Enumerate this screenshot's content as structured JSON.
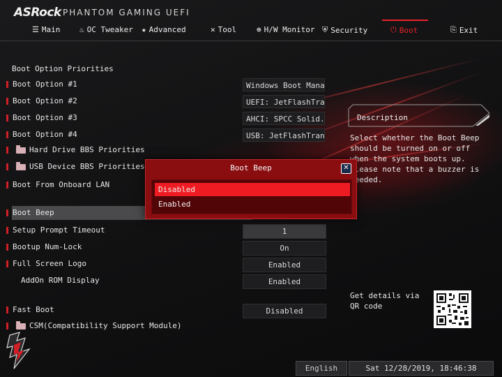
{
  "header": {
    "brand": "ASRock",
    "subtitle": "PHANTOM GAMING UEFI"
  },
  "nav": [
    {
      "label": "Main",
      "icon": "list-icon"
    },
    {
      "label": "OC Tweaker",
      "icon": "flame-icon"
    },
    {
      "label": "Advanced",
      "icon": "star-icon"
    },
    {
      "label": "Tool",
      "icon": "tools-icon"
    },
    {
      "label": "H/W Monitor",
      "icon": "globe-icon"
    },
    {
      "label": "Security",
      "icon": "shield-icon"
    },
    {
      "label": "Boot",
      "icon": "power-icon",
      "active": true
    },
    {
      "label": "Exit",
      "icon": "exit-icon"
    }
  ],
  "boot": {
    "section_title": "Boot Option Priorities",
    "options": [
      {
        "label": "Boot Option #1",
        "value": "Windows Boot Mana..."
      },
      {
        "label": "Boot Option #2",
        "value": "UEFI: JetFlashTra..."
      },
      {
        "label": "Boot Option #3",
        "value": "AHCI:  SPCC Solid..."
      },
      {
        "label": "Boot Option #4",
        "value": "USB: JetFlashTran..."
      }
    ],
    "hdd_bbs": "Hard Drive BBS Priorities",
    "usb_bbs": "USB Device BBS Priorities",
    "onboard_lan": "Boot From Onboard LAN",
    "boot_beep": "Boot Beep",
    "setup_prompt": {
      "label": "Setup Prompt Timeout",
      "value": "1"
    },
    "numlock": {
      "label": "Bootup Num-Lock",
      "value": "On"
    },
    "full_logo": {
      "label": "Full Screen Logo",
      "value": "Enabled"
    },
    "addon_rom": {
      "label": "AddOn ROM Display",
      "value": "Enabled"
    },
    "fast_boot": {
      "label": "Fast Boot",
      "value": "Disabled"
    },
    "csm": "CSM(Compatibility Support Module)"
  },
  "description": {
    "title": "Description",
    "text": "Select whether the Boot Beep should be turned on or off when the system boots up. Please note that a buzzer is needed."
  },
  "qr": {
    "text": "Get details via QR code"
  },
  "popup": {
    "title": "Boot Beep",
    "options": [
      "Disabled",
      "Enabled"
    ],
    "selected_index": 0
  },
  "footer": {
    "language": "English",
    "datetime": "Sat 12/28/2019, 18:46:38"
  },
  "colors": {
    "accent": "#e8232a",
    "popup_bg": "#8a0d10",
    "selected_option": "#ee1c22"
  }
}
